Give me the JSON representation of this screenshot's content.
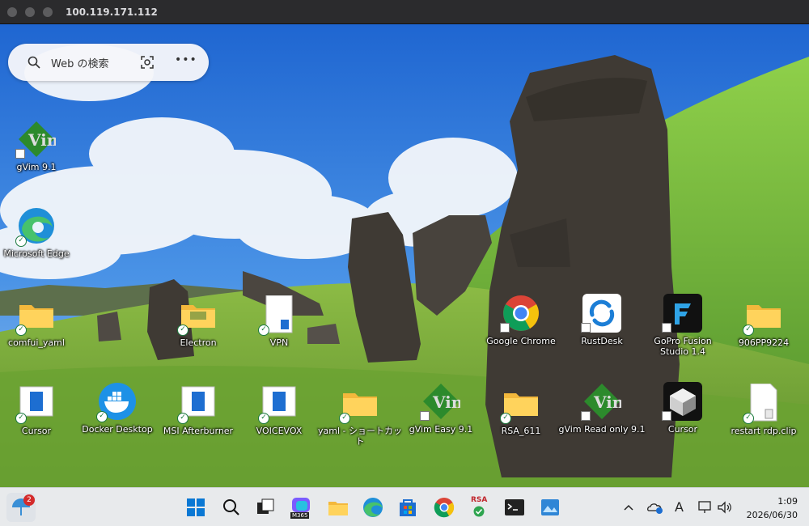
{
  "window": {
    "title": "100.119.171.112"
  },
  "search": {
    "placeholder": "Web の検索",
    "more": "•••"
  },
  "desktop_icons": [
    {
      "label": "gVim 9.1"
    },
    {
      "label": "Microsoft Edge"
    },
    {
      "label": "comfui_yaml"
    },
    {
      "label": "Electron"
    },
    {
      "label": "VPN"
    },
    {
      "label": "Google Chrome"
    },
    {
      "label": "RustDesk"
    },
    {
      "label": "GoPro Fusion Studio 1.4"
    },
    {
      "label": "906PP9224"
    },
    {
      "label": "Cursor"
    },
    {
      "label": "Docker Desktop"
    },
    {
      "label": "MSI Afterburner"
    },
    {
      "label": "VOICEVOX"
    },
    {
      "label": "yaml - ショートカット"
    },
    {
      "label": "gVim Easy 9.1"
    },
    {
      "label": "RSA_611"
    },
    {
      "label": "gVim Read only 9.1"
    },
    {
      "label": "Cursor"
    },
    {
      "label": "restart rdp.clip"
    }
  ],
  "taskbar": {
    "weather_badge": "2",
    "rsa_label": "RSA",
    "m365_label": "M365",
    "ime": "A",
    "clock_time": "1:09",
    "clock_date": "2026/06/30"
  },
  "colors": {
    "taskbar_bg": "#e8eaec",
    "sky": "#2c78d6",
    "grass": "#7bbf3a",
    "accent": "#0067c0"
  }
}
